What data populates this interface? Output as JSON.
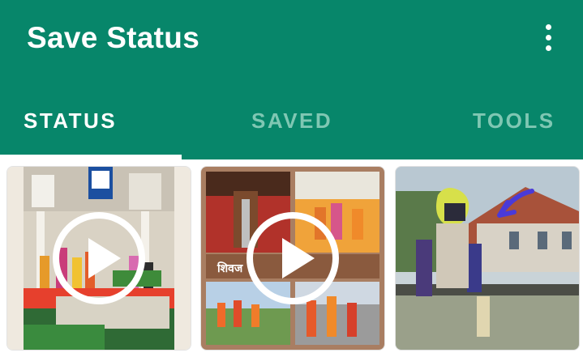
{
  "app": {
    "title": "Save Status"
  },
  "tabs": [
    {
      "label": "STATUS",
      "active": true
    },
    {
      "label": "SAVED",
      "active": false
    },
    {
      "label": "TOOLS",
      "active": false
    }
  ],
  "colors": {
    "primary": "#07866a",
    "tab_inactive": "#7fc7b3",
    "indicator": "#ffffff"
  },
  "icons": {
    "menu": "more-vert-icon",
    "play": "play-icon"
  },
  "statuses": [
    {
      "type": "video",
      "overlay_icon": "play-icon"
    },
    {
      "type": "video",
      "overlay_icon": "play-icon"
    },
    {
      "type": "image"
    }
  ]
}
